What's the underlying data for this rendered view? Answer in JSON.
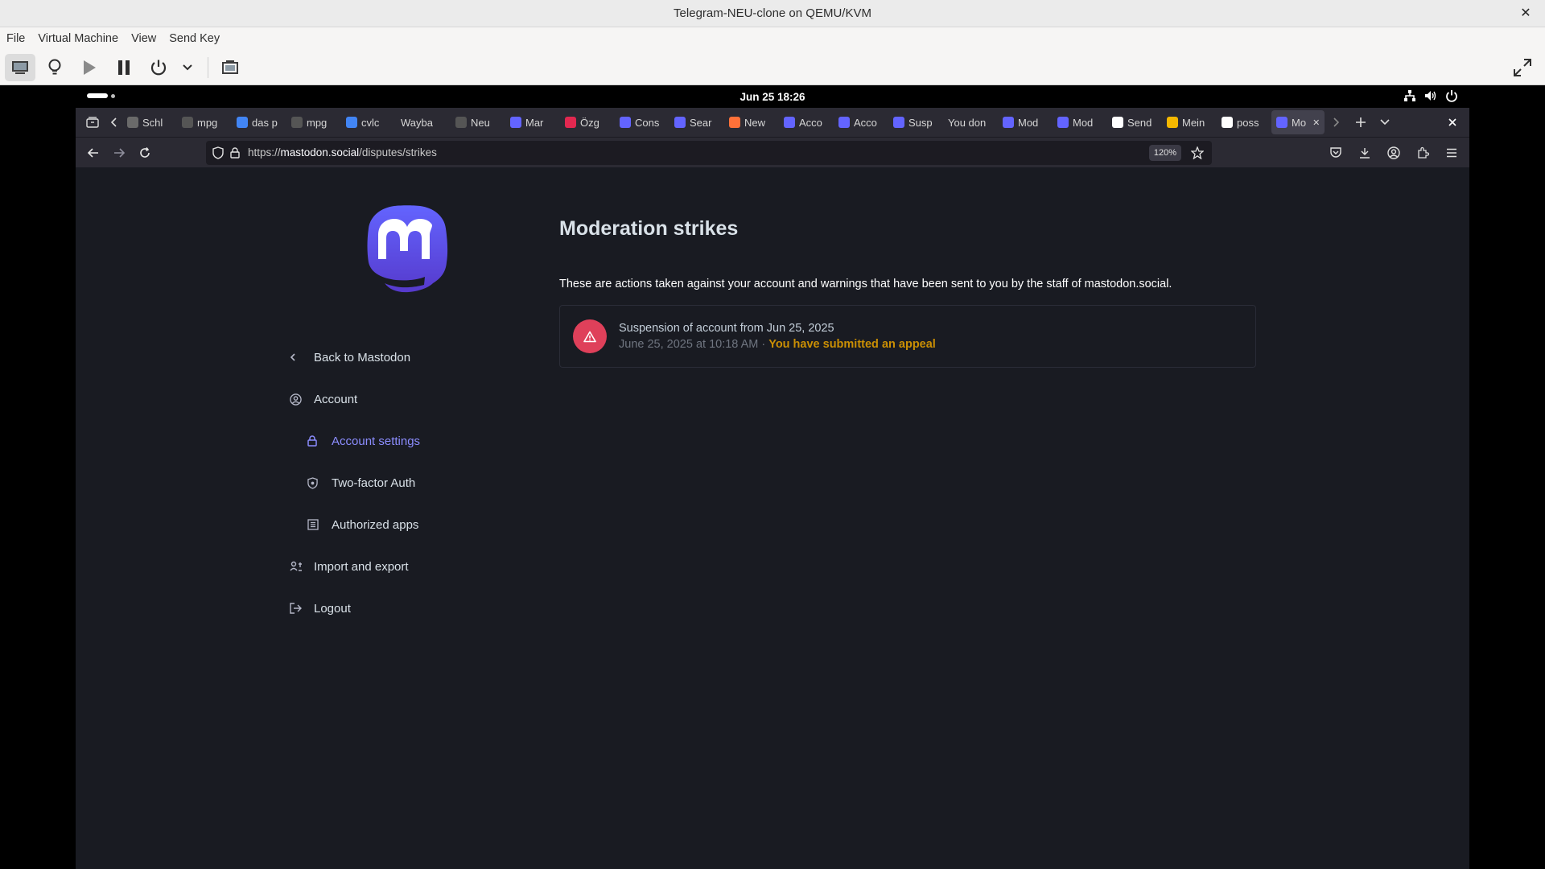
{
  "vm": {
    "title": "Telegram-NEU-clone on QEMU/KVM",
    "menu": [
      "File",
      "Virtual Machine",
      "View",
      "Send Key"
    ]
  },
  "gnome": {
    "clock": "Jun 25  18:26"
  },
  "browser": {
    "tabs": [
      {
        "label": "Schl",
        "color": "#6a6a6a"
      },
      {
        "label": "mpg",
        "color": "#555555"
      },
      {
        "label": "das p",
        "color": "#4285f4"
      },
      {
        "label": "mpg",
        "color": "#555555"
      },
      {
        "label": "cvlc",
        "color": "#4285f4"
      },
      {
        "label": "Wayba",
        "color": ""
      },
      {
        "label": "Neu",
        "color": "#555555"
      },
      {
        "label": "Mar",
        "color": "#6364ff"
      },
      {
        "label": "Özg",
        "color": "#e22850"
      },
      {
        "label": "Cons",
        "color": "#6364ff"
      },
      {
        "label": "Sear",
        "color": "#6364ff"
      },
      {
        "label": "New",
        "color": "#ff7139"
      },
      {
        "label": "Acco",
        "color": "#6364ff"
      },
      {
        "label": "Acco",
        "color": "#6364ff"
      },
      {
        "label": "Susp",
        "color": "#6364ff"
      },
      {
        "label": "You don",
        "color": ""
      },
      {
        "label": "Mod",
        "color": "#6364ff"
      },
      {
        "label": "Mod",
        "color": "#6364ff"
      },
      {
        "label": "Send",
        "color": "#ffffff"
      },
      {
        "label": "Mein",
        "color": "#f5b800"
      },
      {
        "label": "poss",
        "color": "#ffffff"
      },
      {
        "label": "Mo",
        "color": "#6364ff",
        "active": true
      }
    ],
    "url_prefix": "https://",
    "url_host": "mastodon.social",
    "url_path": "/disputes/strikes",
    "zoom": "120%"
  },
  "page": {
    "nav": {
      "back": "Back to Mastodon",
      "account": "Account",
      "account_settings": "Account settings",
      "two_factor": "Two-factor Auth",
      "authorized_apps": "Authorized apps",
      "import_export": "Import and export",
      "logout": "Logout"
    },
    "title": "Moderation strikes",
    "lead": "These are actions taken against your account and warnings that have been sent to you by the staff of mastodon.social.",
    "strike": {
      "title": "Suspension of account from Jun 25, 2025",
      "date": "June 25, 2025 at 10:18 AM",
      "separator": " · ",
      "status": "You have submitted an appeal"
    }
  },
  "colors": {
    "accent": "#8c8dff",
    "danger": "#df405a",
    "warning": "#ca8f04",
    "brand": "#6364ff"
  }
}
